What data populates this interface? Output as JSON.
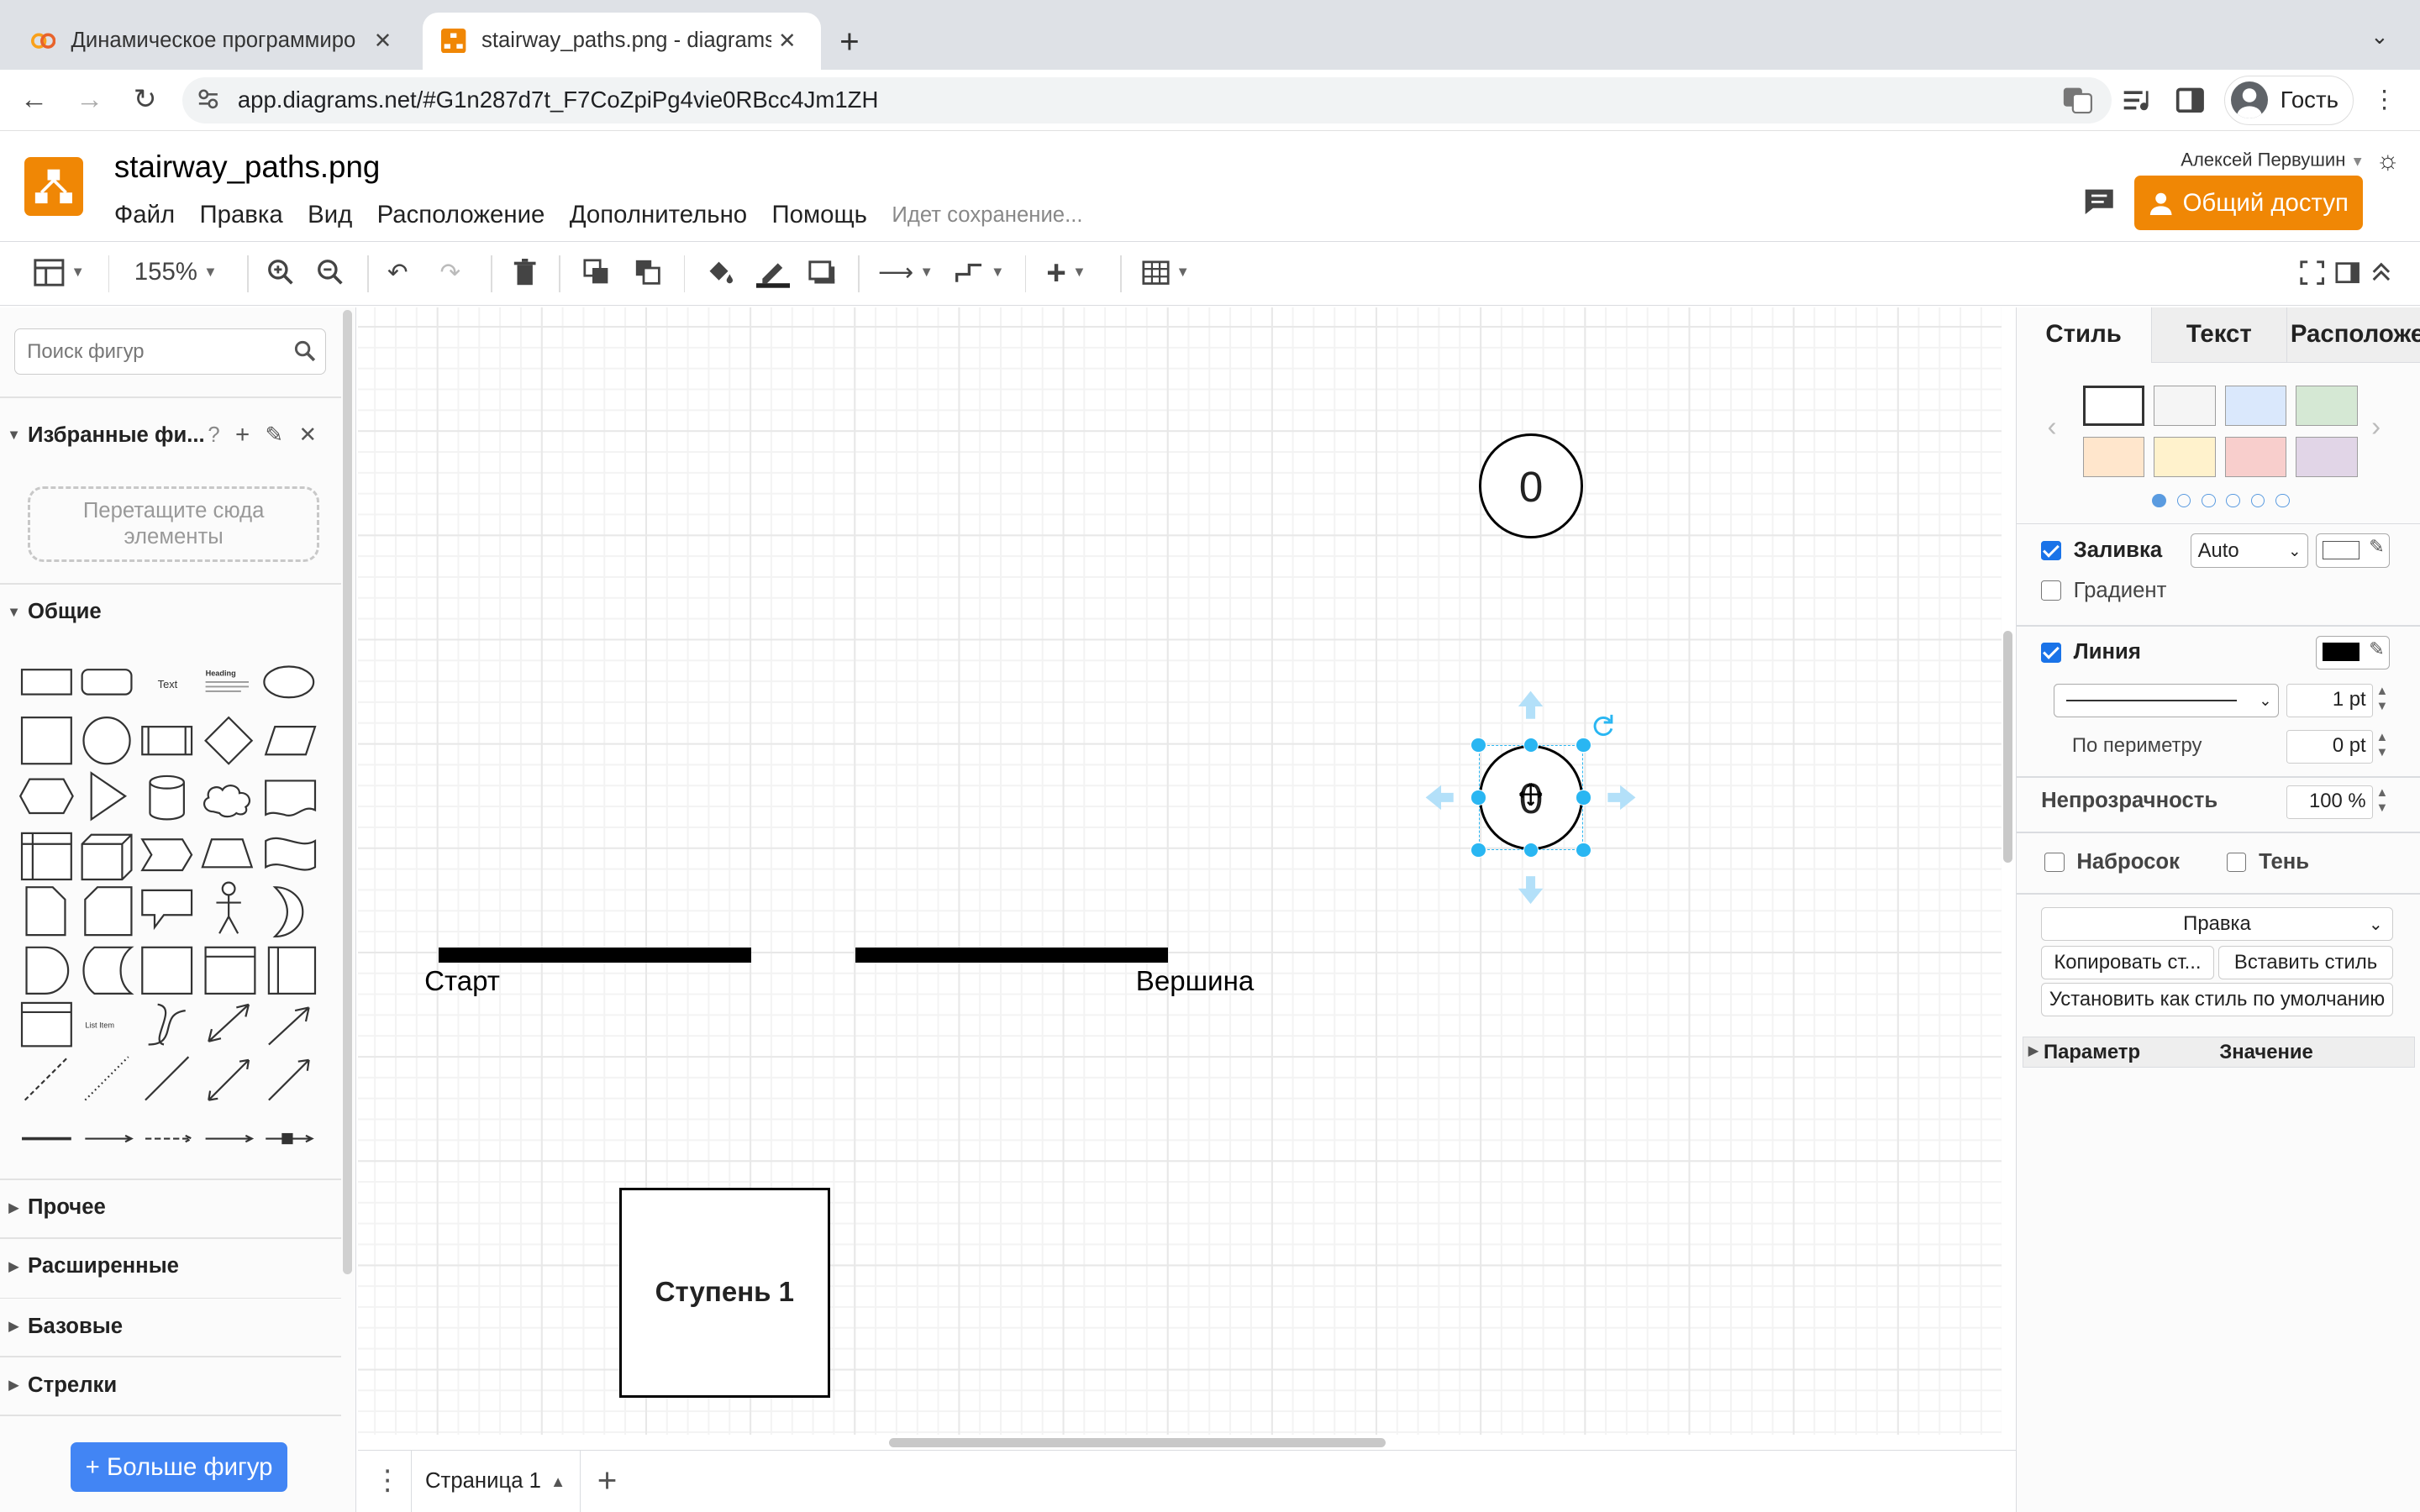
{
  "browser": {
    "tabs": [
      {
        "title": "Динамическое программиро",
        "active": false
      },
      {
        "title": "stairway_paths.png - diagrams",
        "active": true
      }
    ],
    "new_tab": "+",
    "url": "app.diagrams.net/#G1n287d7t_F7CoZpiPg4vie0RBcc4Jm1ZH",
    "profile": "Гость"
  },
  "app": {
    "doc_title": "stairway_paths.png",
    "menu": [
      "Файл",
      "Правка",
      "Вид",
      "Расположение",
      "Дополнительно",
      "Помощь"
    ],
    "status": "Идет сохранение...",
    "user": "Алексей Первушин",
    "share_label": "Общий доступ",
    "accent": "#f08705"
  },
  "toolbar": {
    "zoom": "155%"
  },
  "left": {
    "search_placeholder": "Поиск фигур",
    "favorites_title": "Избранные фи...",
    "favorites_hint_1": "Перетащите сюда",
    "favorites_hint_2": "элементы",
    "general_title": "Общие",
    "shape_text": "Text",
    "shape_heading": "Heading",
    "shape_list_item": "List Item",
    "sections": [
      "Прочее",
      "Расширенные",
      "Базовые",
      "Стрелки"
    ],
    "more_shapes": "+ Больше фигур"
  },
  "canvas": {
    "circle_top_label": "0",
    "circle_selected_label": "0",
    "start_label": "Старт",
    "top_label": "Вершина",
    "step_label": "Ступень 1"
  },
  "pages": {
    "current": "Страница 1"
  },
  "format": {
    "tabs": [
      "Стиль",
      "Текст",
      "Расположе"
    ],
    "swatch_colors": [
      "#ffffff",
      "#f5f5f5",
      "#dae8fc",
      "#d5e8d4",
      "#ffe6cc",
      "#fff2cc",
      "#f8cecc",
      "#e1d5e7"
    ],
    "fill_label": "Заливка",
    "fill_mode": "Auto",
    "gradient_label": "Градиент",
    "line_label": "Линия",
    "line_width": "1 pt",
    "perimeter_label": "По периметру",
    "perimeter_value": "0 pt",
    "opacity_label": "Непрозрачность",
    "opacity_value": "100 %",
    "sketch_label": "Набросок",
    "shadow_label": "Тень",
    "edit_select": "Правка",
    "copy_style": "Копировать ст...",
    "paste_style": "Вставить стиль",
    "set_default": "Установить как стиль по умолчанию",
    "param_header": "Параметр",
    "value_header": "Значение"
  }
}
